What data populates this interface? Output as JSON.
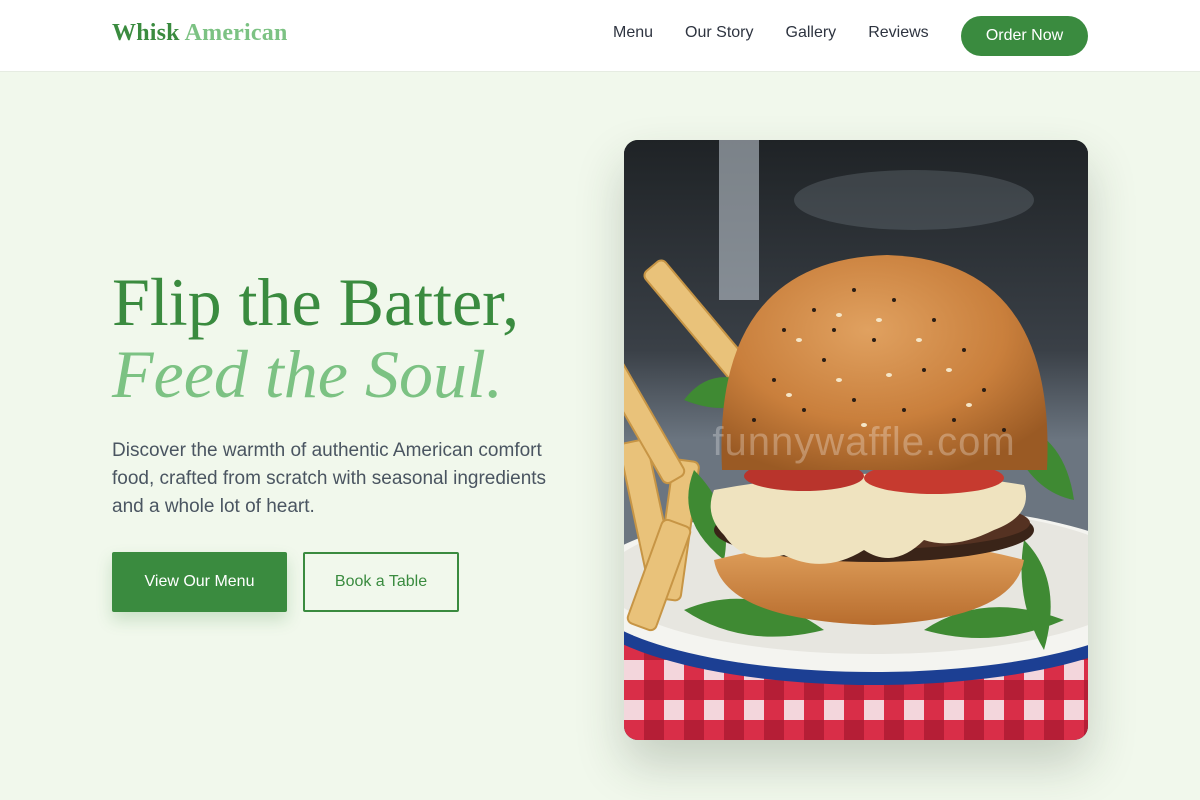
{
  "brand": {
    "name_part1": "Whisk",
    "name_part2": "American"
  },
  "nav": {
    "links": [
      "Menu",
      "Our Story",
      "Gallery",
      "Reviews"
    ],
    "cta": "Order Now"
  },
  "hero": {
    "title_line1": "Flip the Batter,",
    "title_line2": "Feed the Soul.",
    "subtitle": "Discover the warmth of authentic American comfort food, crafted from scratch with seasonal ingredients and a whole lot of heart.",
    "primary_button": "View Our Menu",
    "secondary_button": "Book a Table",
    "image_watermark": "funnywaffle.com"
  },
  "colors": {
    "accent": "#3a8b3f",
    "accent_light": "#7cc283",
    "background": "#f1f8ec"
  }
}
